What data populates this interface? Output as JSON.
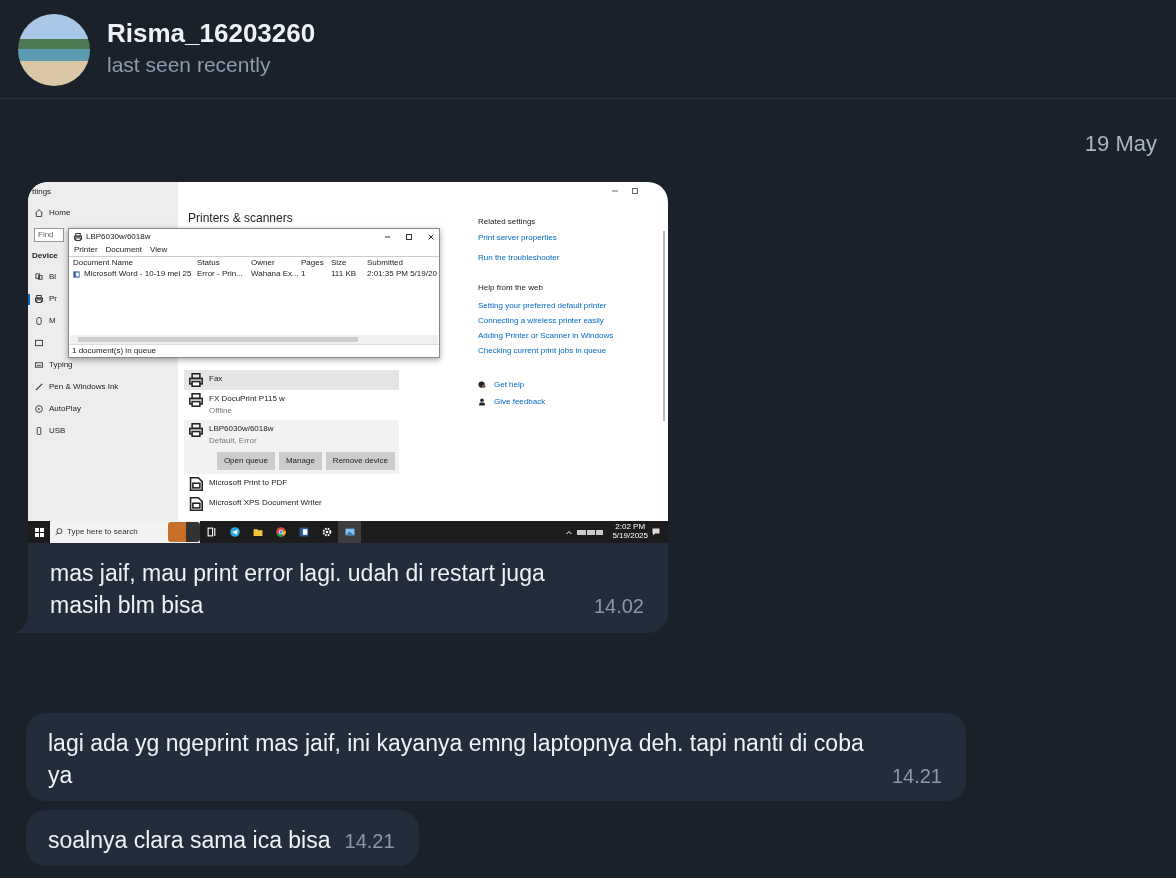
{
  "header": {
    "name": "Risma_16203260",
    "status": "last seen recently"
  },
  "date_separator": "19 May",
  "messages": [
    {
      "kind": "photo",
      "text": "mas jaif, mau print error lagi. udah di restart juga masih blm bisa",
      "time": "14.02",
      "tail": true
    },
    {
      "kind": "text",
      "text": "lagi ada yg ngeprint mas jaif, ini kayanya emng laptopnya deh. tapi nanti di coba ya",
      "time": "14.21",
      "tail": false
    },
    {
      "kind": "text",
      "text": "soalnya clara sama ica bisa",
      "time": "14.21",
      "tail": false
    }
  ],
  "screenshot": {
    "window_title": "ttings",
    "sidebar": {
      "home": "Home",
      "search_placeholder": "Find",
      "section": "Device",
      "items": [
        {
          "label": "Bl",
          "kind": "devices",
          "selected": false
        },
        {
          "label": "Pr",
          "kind": "printer",
          "selected": true
        },
        {
          "label": "M",
          "kind": "mouse",
          "selected": false
        },
        {
          "kind": "touchpad",
          "selected": false
        },
        {
          "label": "Typing",
          "kind": "keyboard",
          "selected": false
        },
        {
          "label": "Pen & Windows Ink",
          "kind": "pen",
          "selected": false
        },
        {
          "label": "AutoPlay",
          "kind": "autoplay",
          "selected": false
        },
        {
          "label": "USB",
          "kind": "usb",
          "selected": false
        }
      ]
    },
    "page_title": "Printers & scanners",
    "printers": [
      {
        "name": "Fax",
        "kind": "printer",
        "highlighted": true,
        "expanded": false
      },
      {
        "name": "FX DocuPrint P115 w",
        "status": "Offline",
        "kind": "printer",
        "highlighted": false,
        "expanded": false
      },
      {
        "name": "LBP6030w/6018w",
        "status": "Default, Error",
        "kind": "printer",
        "highlighted": false,
        "expanded": true,
        "buttons": [
          "Open queue",
          "Manage",
          "Remove device"
        ]
      },
      {
        "name": "Microsoft Print to PDF",
        "kind": "document",
        "highlighted": false,
        "expanded": false
      },
      {
        "name": "Microsoft XPS Document Writer",
        "kind": "document",
        "highlighted": false,
        "expanded": false
      }
    ],
    "related": [
      {
        "heading": "Related settings",
        "links": [
          "Print server properties",
          "Run the troubleshooter"
        ]
      },
      {
        "heading": "Help from the web",
        "links": [
          "Setting your preferred default printer",
          "Connecting a wireless printer easily",
          "Adding Printer or Scanner in Windows",
          "Checking current print jobs in queue"
        ]
      }
    ],
    "support": [
      {
        "label": "Get help",
        "kind": "help"
      },
      {
        "label": "Give feedback",
        "kind": "feedback"
      }
    ],
    "queue_window": {
      "title": "LBP6030w/6018w",
      "menu": [
        "Printer",
        "Document",
        "View"
      ],
      "columns": [
        "Document Name",
        "Status",
        "Owner",
        "Pages",
        "Size",
        "Submitted"
      ],
      "rows": [
        [
          "Microsoft Word - 10-19 mei 25",
          "Error - Prin...",
          "Wahana Ex...",
          "1",
          "111 KB",
          "2:01:35 PM  5/19/20"
        ]
      ],
      "status": "1 document(s) in queue"
    },
    "taskbar": {
      "search_placeholder": "Type here to search",
      "apps": [
        {
          "kind": "taskview",
          "active": false
        },
        {
          "kind": "telegram",
          "active": false
        },
        {
          "kind": "folder",
          "active": false
        },
        {
          "kind": "chrome",
          "active": false
        },
        {
          "kind": "word",
          "active": false
        },
        {
          "kind": "gear",
          "active": false
        },
        {
          "kind": "photos",
          "active": true
        }
      ],
      "time": "2:02 PM",
      "date": "5/19/2025"
    }
  }
}
